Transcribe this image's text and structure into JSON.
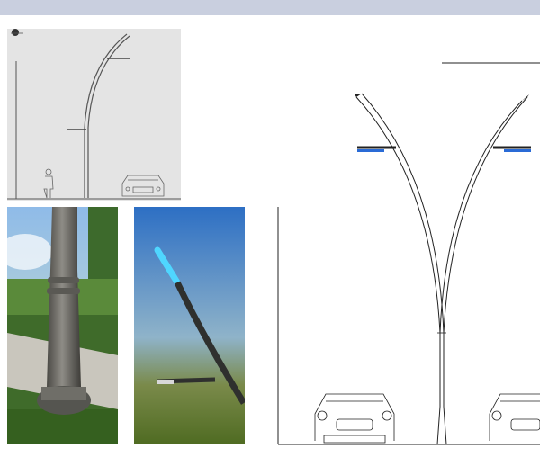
{
  "page": {
    "header_band_color": "#c9cfdf",
    "background_color": "#ffffff"
  },
  "panels": {
    "side_sketch": {
      "background": "#e4e4e4",
      "line_color": "#555555"
    },
    "base_photo": {
      "pole_color": "#6b6a65",
      "grass_color": "#3f6b2a",
      "sky_color": "#9cc3e6"
    },
    "head_photo": {
      "light_color": "#4fd6ff",
      "sky_color": "#3d7cc9",
      "arm_color": "#2f302e"
    },
    "front_elevation": {
      "line_color": "#222222"
    }
  }
}
